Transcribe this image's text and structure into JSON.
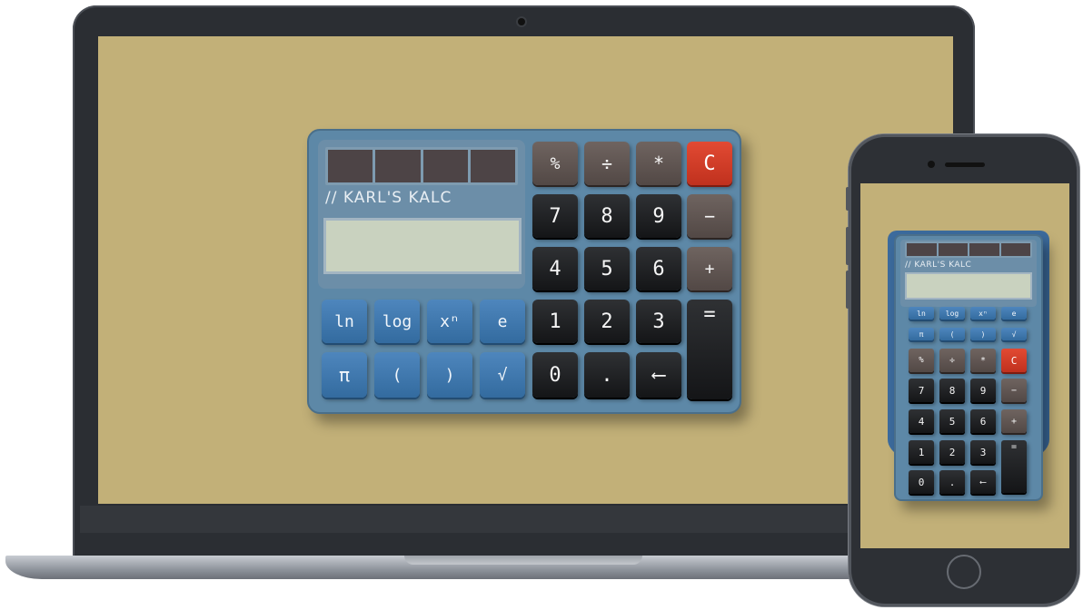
{
  "brand": "// KARL'S KALC",
  "display": {
    "value": ""
  },
  "keys": {
    "ln": "ln",
    "log": "log",
    "pow": "xⁿ",
    "e": "e",
    "pi": "π",
    "lparen": "(",
    "rparen": ")",
    "sqrt": "√",
    "percent": "%",
    "divide": "÷",
    "multiply": "*",
    "clear": "C",
    "seven": "7",
    "eight": "8",
    "nine": "9",
    "minus": "−",
    "four": "4",
    "five": "5",
    "six": "6",
    "plus": "+",
    "one": "1",
    "two": "2",
    "three": "3",
    "equals": "=",
    "zero": "0",
    "dot": ".",
    "backspace": "⟵"
  },
  "colors": {
    "background": "#c2b078",
    "calculator_body": "#5d88a7",
    "fn_key": "#4e86bd",
    "number_key": "#1f2123",
    "operator_key": "#5f5451",
    "clear_key": "#d23d27",
    "lcd": "#c9d2bf"
  }
}
